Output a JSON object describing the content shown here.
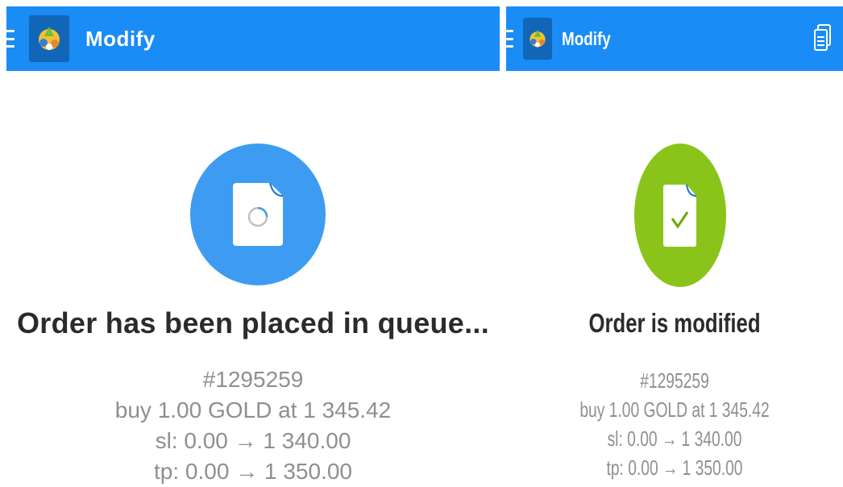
{
  "left_screen": {
    "header": {
      "title": "Modify",
      "menu_icon": "hamburger-icon",
      "logo": "metatrader-logo"
    },
    "status": {
      "icon": "pending-document-icon",
      "color": "#3d9cf2",
      "headline": "Order has been placed in queue..."
    },
    "order": {
      "ticket": "#1295259",
      "summary": "buy 1.00 GOLD at 1 345.42",
      "sl": "sl: 0.00 → 1 340.00",
      "tp": "tp: 0.00 → 1 350.00"
    }
  },
  "right_screen": {
    "header": {
      "title": "Modify",
      "menu_icon": "hamburger-icon",
      "logo": "metatrader-logo",
      "action_icon": "document-list-icon"
    },
    "status": {
      "icon": "document-check-icon",
      "color": "#8ac41a",
      "headline": "Order is modified"
    },
    "order": {
      "ticket": "#1295259",
      "summary": "buy 1.00 GOLD at 1 345.42",
      "sl": "sl: 0.00 → 1 340.00",
      "tp": "tp: 0.00 → 1 350.00"
    }
  },
  "colors": {
    "topbar": "#1a8cf5",
    "headline": "#2b2b2b",
    "details": "#8f8f8f"
  }
}
